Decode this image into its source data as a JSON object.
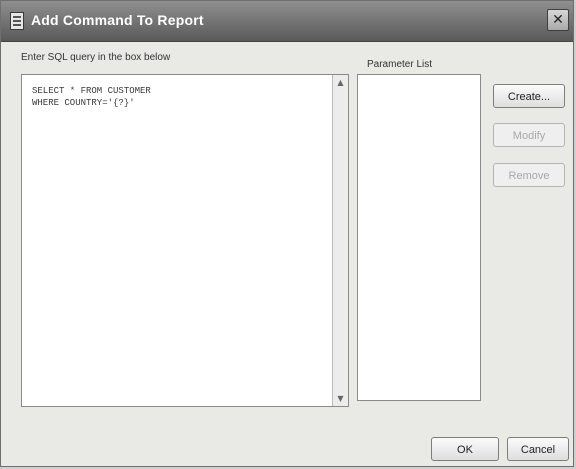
{
  "window": {
    "title": "Add Command To Report",
    "close_glyph": "✕"
  },
  "sql": {
    "instruction": "Enter SQL query in the box below",
    "query": "SELECT * FROM CUSTOMER\nWHERE COUNTRY='{?}'",
    "scroll_up_glyph": "▲",
    "scroll_down_glyph": "▼"
  },
  "parameters": {
    "label": "Parameter List",
    "items": []
  },
  "buttons": {
    "create": "Create...",
    "modify": "Modify",
    "delete": "Remove",
    "ok": "OK",
    "cancel": "Cancel"
  }
}
